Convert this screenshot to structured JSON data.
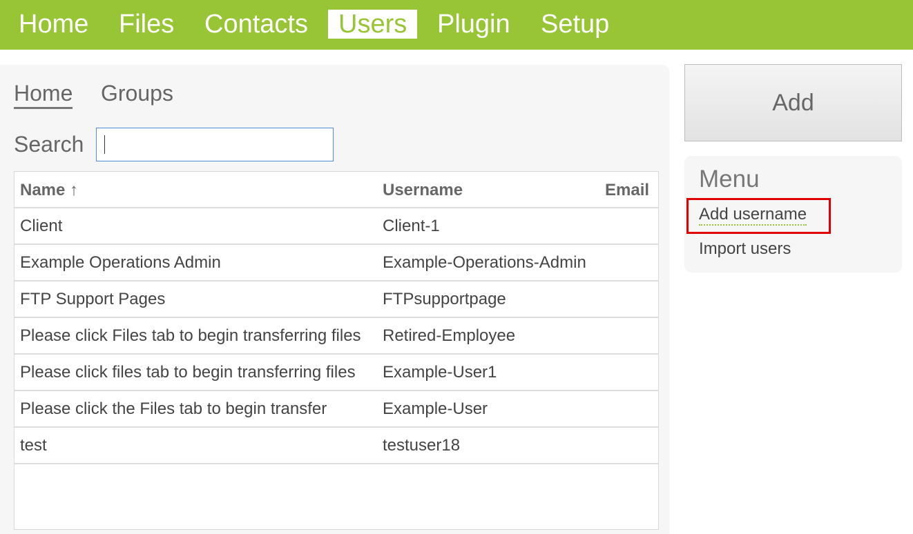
{
  "top_nav": {
    "items": [
      "Home",
      "Files",
      "Contacts",
      "Users",
      "Plugin",
      "Setup"
    ],
    "active": "Users"
  },
  "sub_tabs": {
    "home": "Home",
    "groups": "Groups"
  },
  "search": {
    "label": "Search",
    "value": ""
  },
  "table": {
    "headers": {
      "name": "Name ↑",
      "username": "Username",
      "email": "Email"
    },
    "rows": [
      {
        "name": "Client",
        "username": "Client-1",
        "email": ""
      },
      {
        "name": "Example Operations Admin",
        "username": "Example-Operations-Admin",
        "email": ""
      },
      {
        "name": "FTP Support Pages",
        "username": "FTPsupportpage",
        "email": ""
      },
      {
        "name": "Please click Files tab to begin transferring files",
        "username": "Retired-Employee",
        "email": ""
      },
      {
        "name": "Please click files tab to begin transferring files",
        "username": "Example-User1",
        "email": ""
      },
      {
        "name": "Please click the Files tab to begin transfer",
        "username": "Example-User",
        "email": ""
      },
      {
        "name": "test",
        "username": "testuser18",
        "email": ""
      }
    ]
  },
  "sidebar": {
    "add_label": "Add",
    "menu_title": "Menu",
    "menu_items": [
      "Add username",
      "Import users"
    ]
  },
  "colors": {
    "brand_green": "#98c535",
    "highlight_red": "#e00000"
  }
}
